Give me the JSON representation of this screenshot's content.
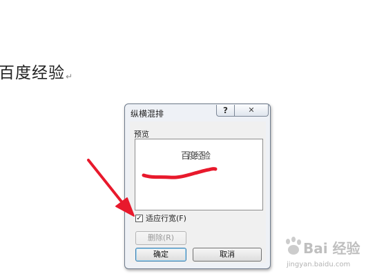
{
  "document": {
    "text": "百度经验",
    "para_mark": "↵"
  },
  "dialog": {
    "title": "纵横混排",
    "help_label": "?",
    "close_label": "✕",
    "preview_label": "预览",
    "preview_text": "百度经验",
    "fit_line_width": {
      "label": "适应行宽(F)",
      "checked": true,
      "check_glyph": "✓"
    },
    "delete_button": "删除(R)",
    "ok_button": "确定",
    "cancel_button": "取消"
  },
  "watermark": {
    "main": "Bai 经验",
    "sub": "jingyan.baidu.com"
  },
  "colors": {
    "annotation_red": "#e8192c",
    "dialog_border": "#6f7b8c",
    "default_button_border": "#3c7fb1"
  }
}
